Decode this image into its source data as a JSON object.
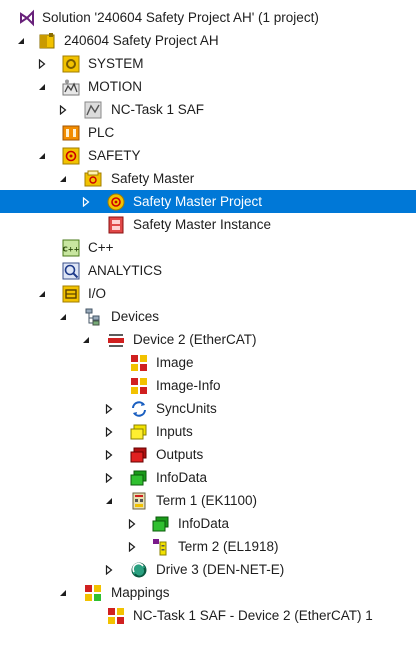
{
  "tree": {
    "solution_label": "Solution '240604 Safety Project AH' (1 project)",
    "project_label": "240604 Safety Project AH",
    "system_label": "SYSTEM",
    "motion_label": "MOTION",
    "nc_task_label": "NC-Task 1 SAF",
    "plc_label": "PLC",
    "safety_label": "SAFETY",
    "safety_master_label": "Safety Master",
    "safety_master_project_label": "Safety Master Project",
    "safety_master_instance_label": "Safety Master Instance",
    "cpp_label": "C++",
    "analytics_label": "ANALYTICS",
    "io_label": "I/O",
    "devices_label": "Devices",
    "device2_label": "Device 2 (EtherCAT)",
    "image_label": "Image",
    "image_info_label": "Image-Info",
    "syncunits_label": "SyncUnits",
    "inputs_label": "Inputs",
    "outputs_label": "Outputs",
    "infodata_label": "InfoData",
    "term1_label": "Term 1 (EK1100)",
    "term1_infodata_label": "InfoData",
    "term2_label": "Term 2 (EL1918)",
    "drive3_label": "Drive 3 (DEN-NET-E)",
    "mappings_label": "Mappings",
    "mapping_entry_label": "NC-Task 1 SAF - Device 2 (EtherCAT) 1"
  },
  "colors": {
    "selection": "#0078d7",
    "twincat_yellow": "#f2c200",
    "vs_purple": "#68217a"
  }
}
